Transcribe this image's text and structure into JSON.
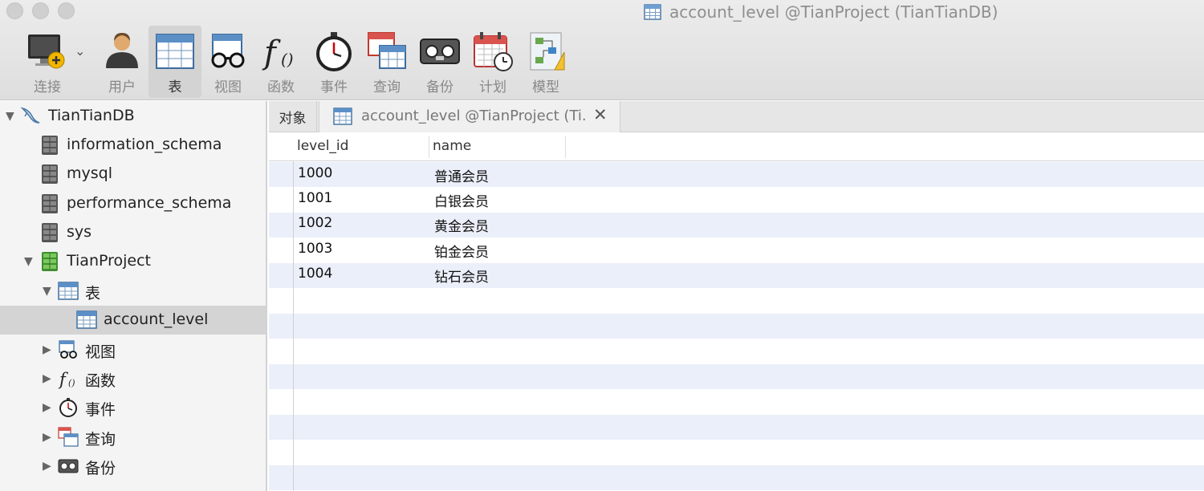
{
  "window": {
    "title": "account_level @TianProject (TianTianDB)"
  },
  "toolbar": {
    "items": [
      {
        "label": "连接",
        "icon": "connection-icon"
      },
      {
        "label": "用户",
        "icon": "user-icon"
      },
      {
        "label": "表",
        "icon": "table-icon",
        "active": true
      },
      {
        "label": "视图",
        "icon": "view-icon"
      },
      {
        "label": "函数",
        "icon": "function-icon"
      },
      {
        "label": "事件",
        "icon": "event-icon"
      },
      {
        "label": "查询",
        "icon": "query-icon"
      },
      {
        "label": "备份",
        "icon": "backup-icon"
      },
      {
        "label": "计划",
        "icon": "schedule-icon"
      },
      {
        "label": "模型",
        "icon": "model-icon"
      }
    ]
  },
  "sidebar": {
    "connection": "TianTianDB",
    "databases": [
      "information_schema",
      "mysql",
      "performance_schema",
      "sys"
    ],
    "project": "TianProject",
    "tables_group": "表",
    "selected_table": "account_level",
    "groups": [
      "视图",
      "函数",
      "事件",
      "查询",
      "备份"
    ]
  },
  "tabs": {
    "objects_label": "对象",
    "active_tab_label": "account_level @TianProject (Ti..."
  },
  "grid": {
    "columns": [
      "level_id",
      "name"
    ],
    "rows": [
      [
        "1000",
        "普通会员"
      ],
      [
        "1001",
        "白银会员"
      ],
      [
        "1002",
        "黄金会员"
      ],
      [
        "1003",
        "铂金会员"
      ],
      [
        "1004",
        "钻石会员"
      ]
    ],
    "stripe_color": "#ebeff9"
  },
  "colors": {
    "toolbar_bg": "#e3e3e3",
    "sidebar_bg": "#f4f4f4",
    "selection_bg": "#d4d4d4",
    "stripe": "#ebeff9"
  }
}
